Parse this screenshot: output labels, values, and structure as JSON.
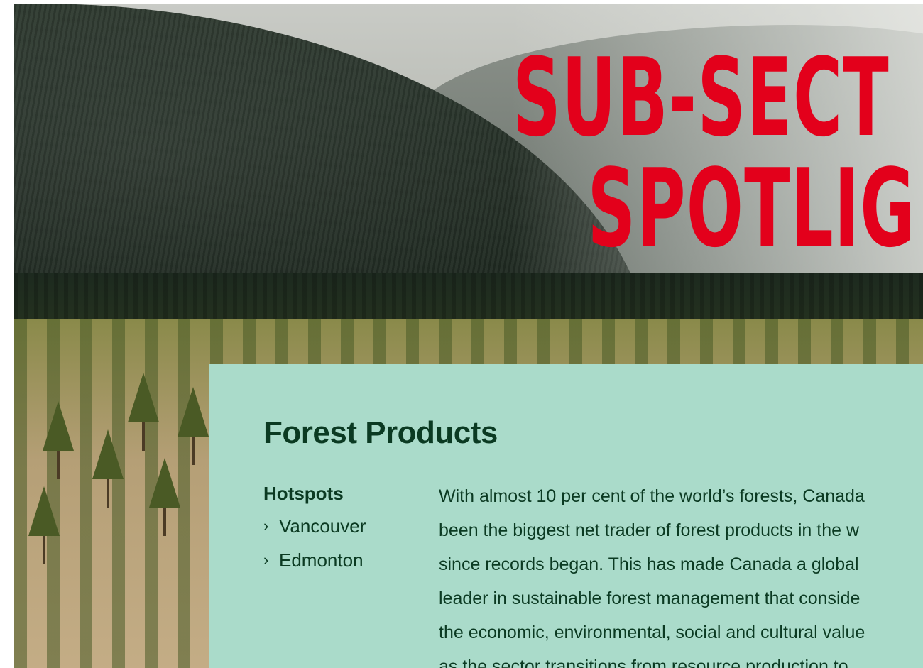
{
  "hero": {
    "title_line1": "SUB-SECT",
    "title_line2": "SPOTLIG",
    "title_color": "#e3001b"
  },
  "card": {
    "background": "#aadbca",
    "title": "Forest Products",
    "hotspots_heading": "Hotspots",
    "hotspots": [
      {
        "label": "Vancouver",
        "icon": "chevron-right-icon"
      },
      {
        "label": "Edmonton",
        "icon": "chevron-right-icon"
      }
    ],
    "body_lines": [
      "With almost 10 per cent of the world’s forests, Canada",
      "been the biggest net trader of forest products in the w",
      "since records began. This has made Canada a global",
      "leader in sustainable forest management that conside",
      "the economic, environmental, social and cultural value",
      "as the sector transitions from resource production to"
    ]
  }
}
